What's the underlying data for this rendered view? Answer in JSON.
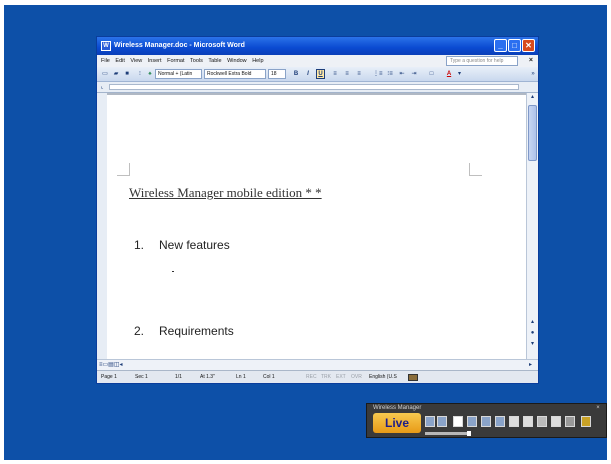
{
  "window": {
    "title": "Wireless Manager.doc - Microsoft Word",
    "minimize": "_",
    "maximize": "□",
    "close": "✕"
  },
  "menubar": {
    "items": [
      "File",
      "Edit",
      "View",
      "Insert",
      "Format",
      "Tools",
      "Table",
      "Window",
      "Help"
    ],
    "help_placeholder": "Type a question for help",
    "close": "×"
  },
  "toolbar": {
    "style": "Normal + (Latin",
    "font": "Rockwell Extra Bold",
    "size": "18",
    "bold": "B",
    "italic": "I",
    "underline": "U",
    "font_color": "A"
  },
  "document": {
    "heading": "Wireless Manager mobile edition * *",
    "items": [
      {
        "num": "1.",
        "text": "New features"
      },
      {
        "num": "2.",
        "text": "Requirements"
      }
    ],
    "bullet": "-"
  },
  "statusbar": {
    "page": "Page 1",
    "sec": "Sec 1",
    "pages": "1/1",
    "at": "At 1.3\"",
    "ln": "Ln 1",
    "col": "Col 1",
    "rec": "REC",
    "trk": "TRK",
    "ext": "EXT",
    "ovr": "OVR",
    "language": "English (U.S"
  },
  "wireless_manager": {
    "title": "Wireless Manager",
    "live": "Live"
  },
  "colors": {
    "desktop": "#0d50a8",
    "titlebar": "#0a4ad1",
    "live_button": "#f0ad2a"
  }
}
